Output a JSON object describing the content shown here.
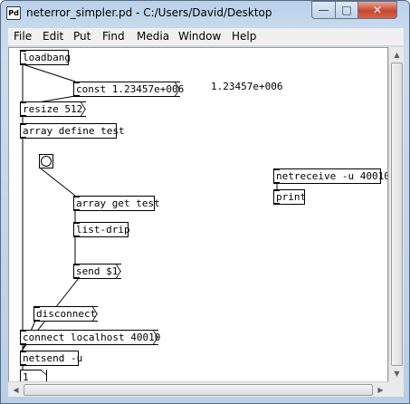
{
  "window": {
    "app_icon_label": "Pd",
    "title": "neterror_simpler.pd  - C:/Users/David/Desktop",
    "minimize_glyph": "—",
    "maximize_glyph": "□",
    "close_glyph": "✕"
  },
  "menu": {
    "items": [
      "File",
      "Edit",
      "Put",
      "Find",
      "Media",
      "Window",
      "Help"
    ]
  },
  "patch": {
    "loadbang": "loadbang",
    "const_msg": "const 1.23457e+006",
    "const_display": "1.23457e+006",
    "resize_msg": "resize 512",
    "array_define": "array define test",
    "netreceive": "netreceive -u 40010",
    "print": "print",
    "array_get": "array get test",
    "list_drip": "list-drip",
    "send_msg": "send $1",
    "disconnect_msg": "disconnect",
    "connect_msg": "connect localhost 40010",
    "netsend": "netsend -u",
    "number_value": "1"
  },
  "scrollbars": {
    "up": "▲",
    "down": "▼",
    "left": "◀",
    "right": "▶"
  }
}
